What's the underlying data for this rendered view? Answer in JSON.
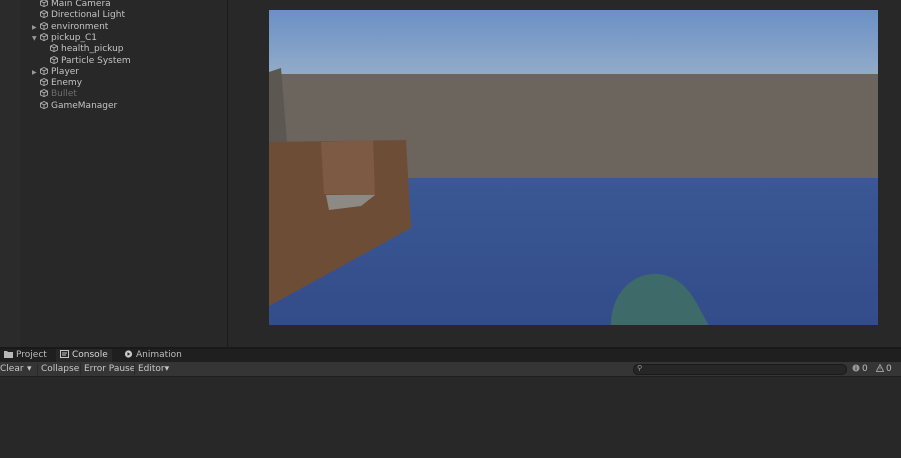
{
  "hierarchy": {
    "items": [
      {
        "label": "Main Camera",
        "expanded": false,
        "has_children": false,
        "active": true
      },
      {
        "label": "Directional Light",
        "expanded": false,
        "has_children": false,
        "active": true
      },
      {
        "label": "environment",
        "expanded": false,
        "has_children": true,
        "active": true
      },
      {
        "label": "pickup_C1",
        "expanded": true,
        "has_children": true,
        "active": true
      },
      {
        "label": "health_pickup",
        "expanded": false,
        "has_children": false,
        "active": true
      },
      {
        "label": "Particle System",
        "expanded": false,
        "has_children": false,
        "active": true
      },
      {
        "label": "Player",
        "expanded": false,
        "has_children": true,
        "active": true
      },
      {
        "label": "Enemy",
        "expanded": false,
        "has_children": false,
        "active": true
      },
      {
        "label": "Bullet",
        "expanded": false,
        "has_children": false,
        "active": false
      },
      {
        "label": "GameManager",
        "expanded": false,
        "has_children": false,
        "active": true
      }
    ]
  },
  "scene": {
    "sky_top": "#6a90c6",
    "sky_bottom": "#93acc8",
    "wall": "#6b655e",
    "ground": "#334c8a",
    "crate": "#6e4d37",
    "blob": "#3e6a6a"
  },
  "bottom_tabs": [
    {
      "label": "Project",
      "icon": "folder-icon",
      "active": false
    },
    {
      "label": "Console",
      "icon": "console-icon",
      "active": true
    },
    {
      "label": "Animation",
      "icon": "animation-icon",
      "active": false
    }
  ],
  "console_toolbar": {
    "clear_label": "Clear",
    "collapse_label": "Collapse",
    "error_pause_label": "Error Pause",
    "editor_label": "Editor",
    "search_placeholder": "",
    "info_count": "0",
    "warning_count": "0"
  }
}
